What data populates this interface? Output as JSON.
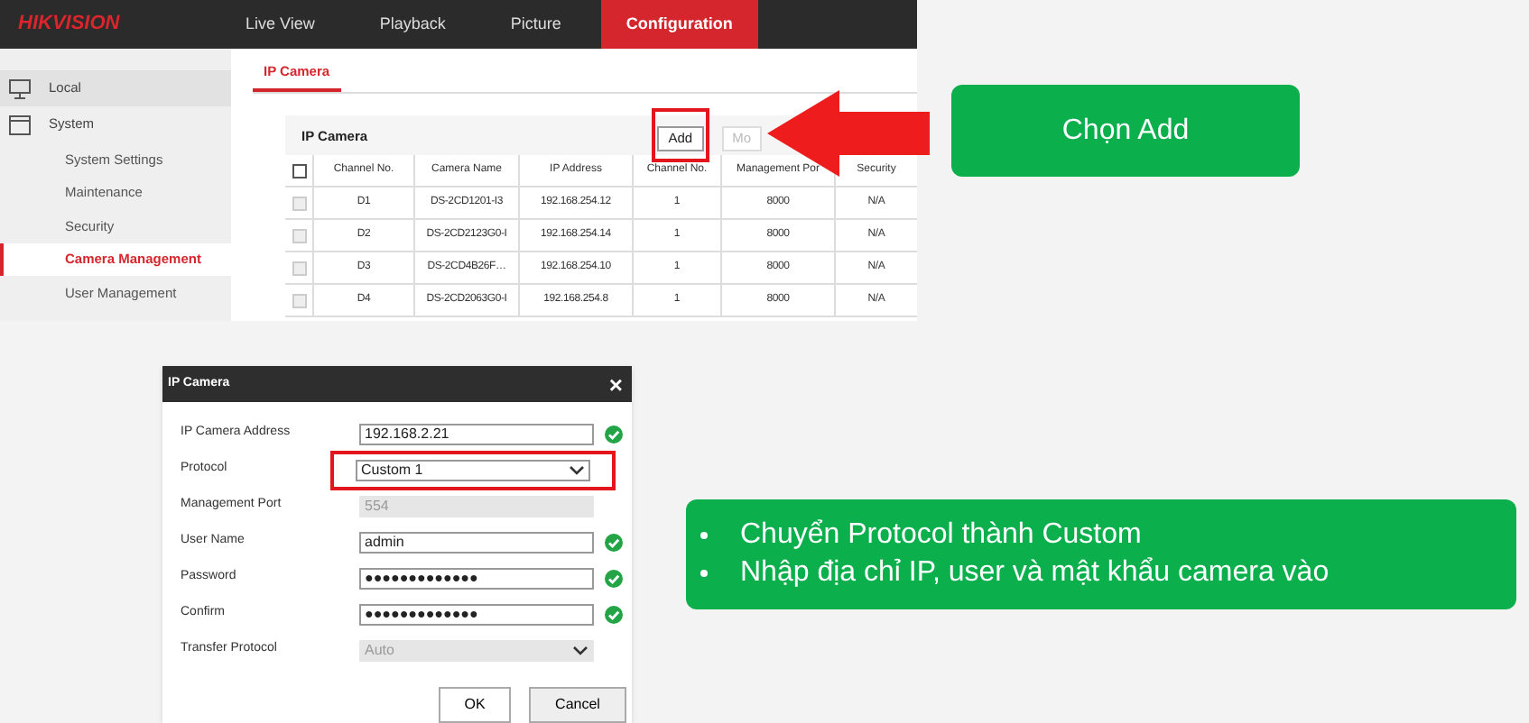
{
  "nvr": {
    "logo": "HIKVISION",
    "nav_tabs": [
      {
        "label": "Live View",
        "selected": false
      },
      {
        "label": "Playback",
        "selected": false
      },
      {
        "label": "Picture",
        "selected": false
      },
      {
        "label": "Configuration",
        "selected": true
      }
    ],
    "sidebar": {
      "items": [
        {
          "label": "Local",
          "selected": false
        },
        {
          "label": "System",
          "selected": false,
          "children": [
            {
              "label": "System Settings",
              "selected": false
            },
            {
              "label": "Maintenance",
              "selected": false
            },
            {
              "label": "Security",
              "selected": false
            },
            {
              "label": "Camera Management",
              "selected": true
            },
            {
              "label": "User Management",
              "selected": false
            }
          ]
        }
      ]
    },
    "sub_tabs": [
      {
        "label": "IP Camera",
        "selected": true
      }
    ],
    "panel": {
      "title": "IP Camera",
      "buttons": [
        {
          "label": "Add",
          "disabled": false,
          "highlighted": true
        },
        {
          "label": "Mo",
          "disabled": true,
          "highlighted": false
        }
      ]
    },
    "table": {
      "columns": [
        "Channel No.",
        "Camera Name",
        "IP Address",
        "Channel No.",
        "Management Por",
        "Security"
      ],
      "rows": [
        {
          "checked": false,
          "cells": [
            "D1",
            "DS-2CD1201-I3",
            "192.168.254.12",
            "1",
            "8000",
            "N/A"
          ]
        },
        {
          "checked": false,
          "cells": [
            "D2",
            "DS-2CD2123G0-I",
            "192.168.254.14",
            "1",
            "8000",
            "N/A"
          ]
        },
        {
          "checked": false,
          "cells": [
            "D3",
            "DS-2CD4B26F…",
            "192.168.254.10",
            "1",
            "8000",
            "N/A"
          ]
        },
        {
          "checked": false,
          "cells": [
            "D4",
            "DS-2CD2063G0-I",
            "192.168.254.8",
            "1",
            "8000",
            "N/A"
          ]
        }
      ]
    }
  },
  "callout_top": {
    "text": "Chọn Add"
  },
  "dialog": {
    "title": "IP Camera",
    "close": "×",
    "fields": [
      {
        "kind": "text",
        "label": "IP Camera Address",
        "value": "192.168.2.21",
        "valid": true,
        "highlighted": false
      },
      {
        "kind": "select",
        "label": "Protocol",
        "value": "Custom 1",
        "valid": false,
        "highlighted": true
      },
      {
        "kind": "disabled",
        "label": "Management Port",
        "value": "554",
        "valid": false,
        "highlighted": false
      },
      {
        "kind": "text",
        "label": "User Name",
        "value": "admin",
        "valid": true,
        "highlighted": false
      },
      {
        "kind": "text",
        "label": "Password",
        "value": "●●●●●●●●●●●●●",
        "valid": true,
        "highlighted": false
      },
      {
        "kind": "text",
        "label": "Confirm",
        "value": "●●●●●●●●●●●●●",
        "valid": true,
        "highlighted": false
      },
      {
        "kind": "disabled-select",
        "label": "Transfer Protocol",
        "value": "Auto",
        "valid": false,
        "highlighted": false
      }
    ],
    "buttons": [
      "OK",
      "Cancel"
    ]
  },
  "callout_bottom": {
    "bullets": [
      "Chuyển Protocol thành Custom",
      "Nhập địa chỉ IP, user và mật khẩu camera vào"
    ]
  }
}
